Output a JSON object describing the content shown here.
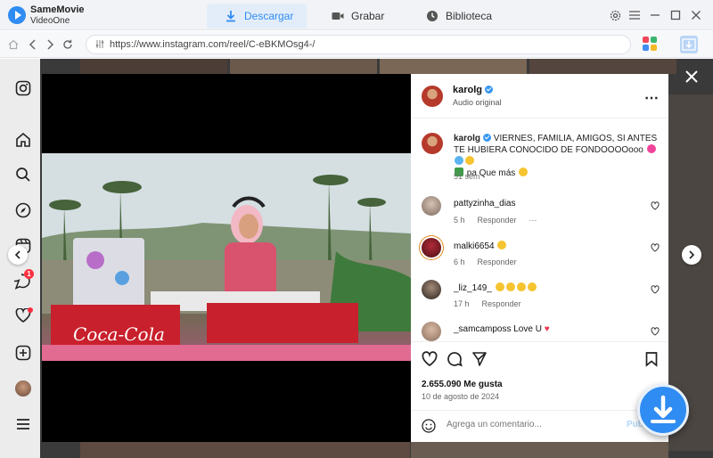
{
  "app": {
    "name": "SameMovie",
    "subname": "VideoOne"
  },
  "tabs": [
    {
      "label": "Descargar",
      "icon": "download-icon",
      "active": true
    },
    {
      "label": "Grabar",
      "icon": "camera-icon",
      "active": false
    },
    {
      "label": "Biblioteca",
      "icon": "clock-icon",
      "active": false
    }
  ],
  "address": {
    "url": "https://www.instagram.com/reel/C-eBKMOsg4-/"
  },
  "colors": {
    "accent": "#2f8cf2",
    "verified": "#3897f0",
    "like": "#e8374e"
  },
  "post": {
    "author": "karolg",
    "audio": "Audio original",
    "caption_user": "karolg",
    "caption_line1": "VIERNES, FAMILIA, AMIGOS, SI ANTES TE",
    "caption_line2": "HUBIERA CONOCIDO DE FONDOOOOooo",
    "caption_line3": "pa Que más",
    "caption_age": "51 sem",
    "likes": "2.655.090 Me gusta",
    "date": "10 de agosto de 2024",
    "comment_placeholder": "Agrega un comentario...",
    "publish": "Publ"
  },
  "comments": [
    {
      "user": "pattyzinha_dias",
      "text": "",
      "age": "5 h",
      "reply": "Responder",
      "more": "···"
    },
    {
      "user": "malki6654",
      "text": "",
      "age": "6 h",
      "reply": "Responder",
      "more": ""
    },
    {
      "user": "_liz_149_",
      "text": "",
      "age": "17 h",
      "reply": "Responder",
      "more": ""
    },
    {
      "user": "_samcamposs",
      "text": "Love U",
      "age": "",
      "reply": "",
      "more": ""
    }
  ],
  "notification_badge": "1"
}
